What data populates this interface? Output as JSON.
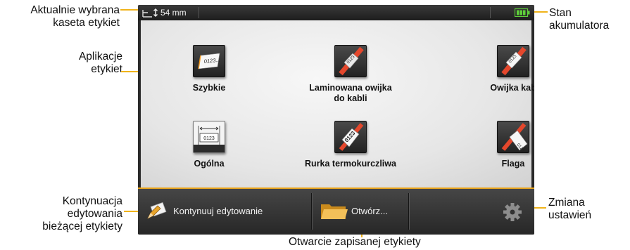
{
  "status": {
    "cassette": "54 mm"
  },
  "apps": [
    {
      "label": "Szybkie"
    },
    {
      "label": "Laminowana owijka\ndo kabli"
    },
    {
      "label": "Owijka kab"
    },
    {
      "label": "Ogólna"
    },
    {
      "label": "Rurka termokurczliwa"
    },
    {
      "label": "Flaga"
    }
  ],
  "icon_text": {
    "quick": "0123...",
    "general": "0123"
  },
  "bottom": {
    "continue": "Kontynuuj edytowanie",
    "open": "Otwórz..."
  },
  "callouts": {
    "cassette": "Aktualnie wybrana\nkaseta etykiet",
    "apps": "Aplikacje\netykiet",
    "continue": "Kontynuacja\nedytowania\nbieżącej etykiety",
    "battery": "Stan\nakumulatora",
    "settings": "Zmiana\nustawień",
    "open": "Otwarcie zapisanej etykiety"
  },
  "colors": {
    "accent": "#f0b31a",
    "battery": "#5fd03a"
  }
}
